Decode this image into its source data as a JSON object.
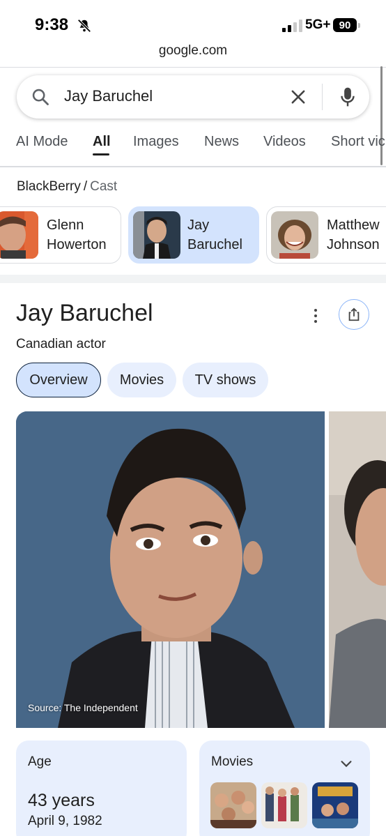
{
  "status_bar": {
    "time": "9:38",
    "network": "5G+",
    "battery": "90"
  },
  "browser": {
    "url": "google.com"
  },
  "search": {
    "query": "Jay Baruchel"
  },
  "tabs": [
    "AI Mode",
    "All",
    "Images",
    "News",
    "Videos",
    "Short vic"
  ],
  "active_tab": "All",
  "breadcrumb": {
    "parent": "BlackBerry",
    "separator": "/",
    "child": "Cast"
  },
  "cast": [
    {
      "line1": "Glenn",
      "line2": "Howerton"
    },
    {
      "line1": "Jay",
      "line2": "Baruchel"
    },
    {
      "line1": "Matthew",
      "line2": "Johnson"
    }
  ],
  "knowledge_panel": {
    "title": "Jay Baruchel",
    "subtitle": "Canadian actor",
    "chips": [
      "Overview",
      "Movies",
      "TV shows"
    ],
    "image_source": "Source: The Independent",
    "age_label": "Age",
    "age_value": "43 years",
    "birth_date": "April 9, 1982",
    "movies_label": "Movies"
  },
  "colors": {
    "accent_chip": "#d3e3fd",
    "chip_bg": "#e8effd",
    "text": "#1f1f1f"
  }
}
